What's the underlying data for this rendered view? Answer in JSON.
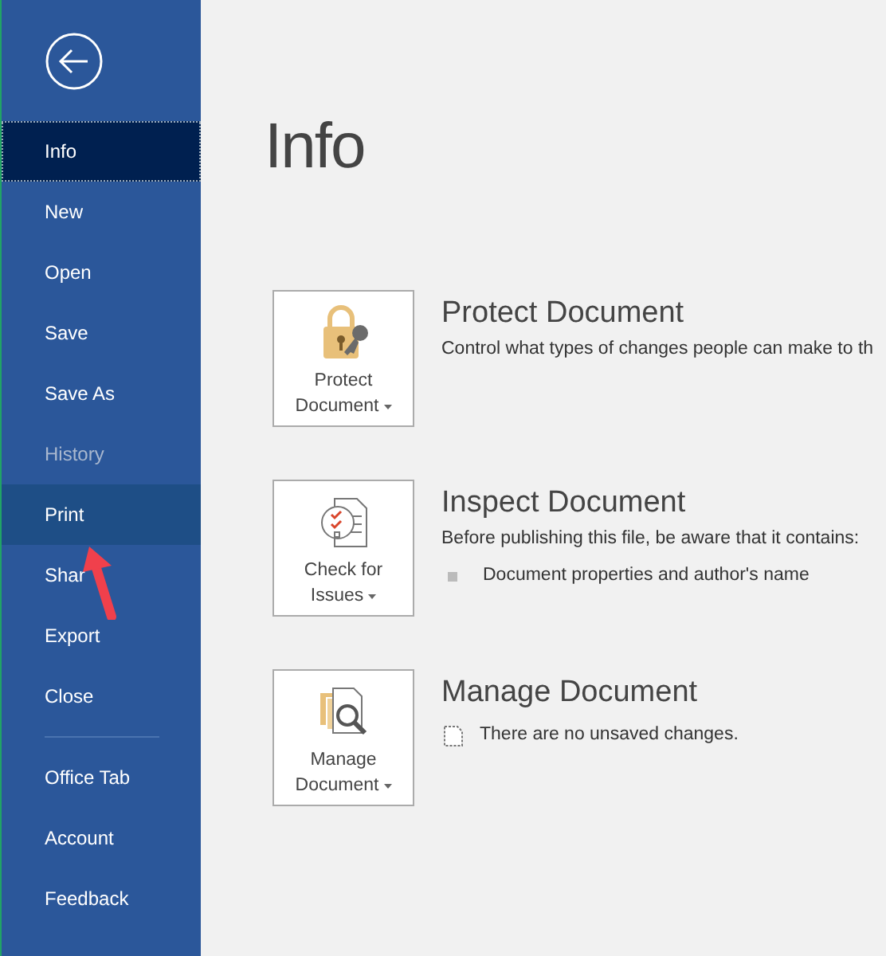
{
  "sidebar": {
    "groups": [
      {
        "items": [
          {
            "label": "Info",
            "selected": true,
            "hovered": false,
            "disabled": false
          },
          {
            "label": "New",
            "selected": false,
            "hovered": false,
            "disabled": false
          },
          {
            "label": "Open",
            "selected": false,
            "hovered": false,
            "disabled": false
          },
          {
            "label": "Save",
            "selected": false,
            "hovered": false,
            "disabled": false
          },
          {
            "label": "Save As",
            "selected": false,
            "hovered": false,
            "disabled": false
          },
          {
            "label": "History",
            "selected": false,
            "hovered": false,
            "disabled": true
          },
          {
            "label": "Print",
            "selected": false,
            "hovered": true,
            "disabled": false
          },
          {
            "label": "Shar",
            "selected": false,
            "hovered": false,
            "disabled": false
          },
          {
            "label": "Export",
            "selected": false,
            "hovered": false,
            "disabled": false
          },
          {
            "label": "Close",
            "selected": false,
            "hovered": false,
            "disabled": false
          }
        ]
      },
      {
        "items": [
          {
            "label": "Office Tab",
            "selected": false,
            "hovered": false,
            "disabled": false
          },
          {
            "label": "Account",
            "selected": false,
            "hovered": false,
            "disabled": false
          },
          {
            "label": "Feedback",
            "selected": false,
            "hovered": false,
            "disabled": false
          }
        ]
      }
    ]
  },
  "page_title": "Info",
  "sections": [
    {
      "kind": "protect",
      "button": [
        "Protect",
        "Document"
      ],
      "title": "Protect Document",
      "description": "Control what types of changes people can make to th"
    },
    {
      "kind": "inspect",
      "button": [
        "Check for",
        "Issues"
      ],
      "title": "Inspect Document",
      "description": "Before publishing this file, be aware that it contains:",
      "bullets": [
        "Document properties and author's name"
      ]
    },
    {
      "kind": "manage",
      "button": [
        "Manage",
        "Document"
      ],
      "title": "Manage Document",
      "note": "There are no unsaved changes."
    }
  ]
}
